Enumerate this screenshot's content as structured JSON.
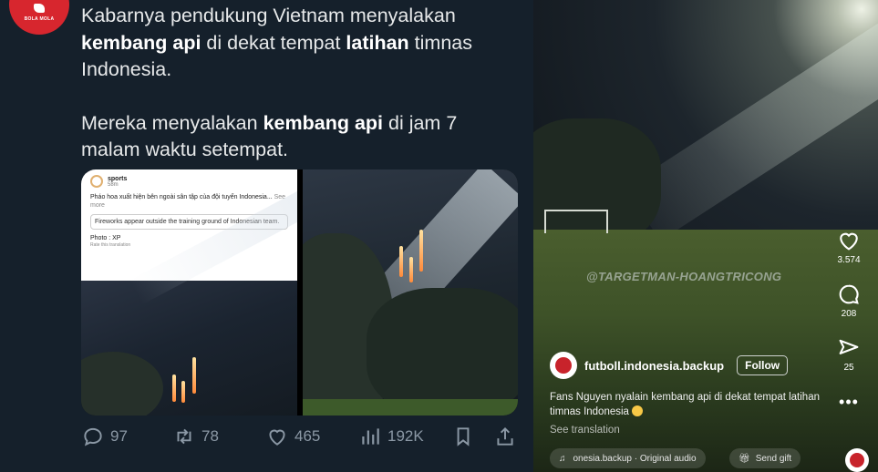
{
  "tweet": {
    "avatar": {
      "brand_text": "BOLA MOLA"
    },
    "paragraph1": {
      "t1": "Kabarnya pendukung Vietnam menyalakan ",
      "b1": "kembang api",
      "t2": " di dekat tempat ",
      "b2": "latihan",
      "t3": " timnas Indonesia."
    },
    "paragraph2": {
      "t1": "Mereka menyalakan ",
      "b1": "kembang api",
      "t2": " di jam 7 malam waktu setempat."
    },
    "embedded_post": {
      "account": "sports",
      "age": "58m",
      "vietnamese_text": "Pháo hoa xuất hiện bên ngoài sân tập của đội tuyển Indonesia...",
      "see_more": "See more",
      "translation": "Fireworks appear outside the training ground of Indonesian team.",
      "photo_credit": "Photo : XP",
      "rate_translation": "Rate this translation"
    },
    "actions": {
      "replies": "97",
      "reposts": "78",
      "likes": "465",
      "views": "192K"
    }
  },
  "video": {
    "watermark": "@TARGETMAN-HOANGTRICONG",
    "likes_count": "3.574",
    "comments_count": "208",
    "shares_count": "25",
    "username": "futboll.indonesia.backup",
    "follow_label": "Follow",
    "caption": "Fans Nguyen nyalain kembang api di dekat tempat latihan timnas Indonesia",
    "see_translation": "See translation",
    "audio_label": "onesia.backup · Original audio",
    "gift_label": "Send gift"
  },
  "colors": {
    "tweet_bg": "#15202b",
    "tweet_text": "#e7e9ea",
    "action_gray": "#8b98a5",
    "brand_red": "#d7262e"
  },
  "icons": [
    "reply-icon",
    "repost-icon",
    "like-icon",
    "views-icon",
    "bookmark-icon",
    "share-icon",
    "heart-icon",
    "comment-icon",
    "send-icon",
    "more-icon",
    "music-icon",
    "gift-icon"
  ]
}
